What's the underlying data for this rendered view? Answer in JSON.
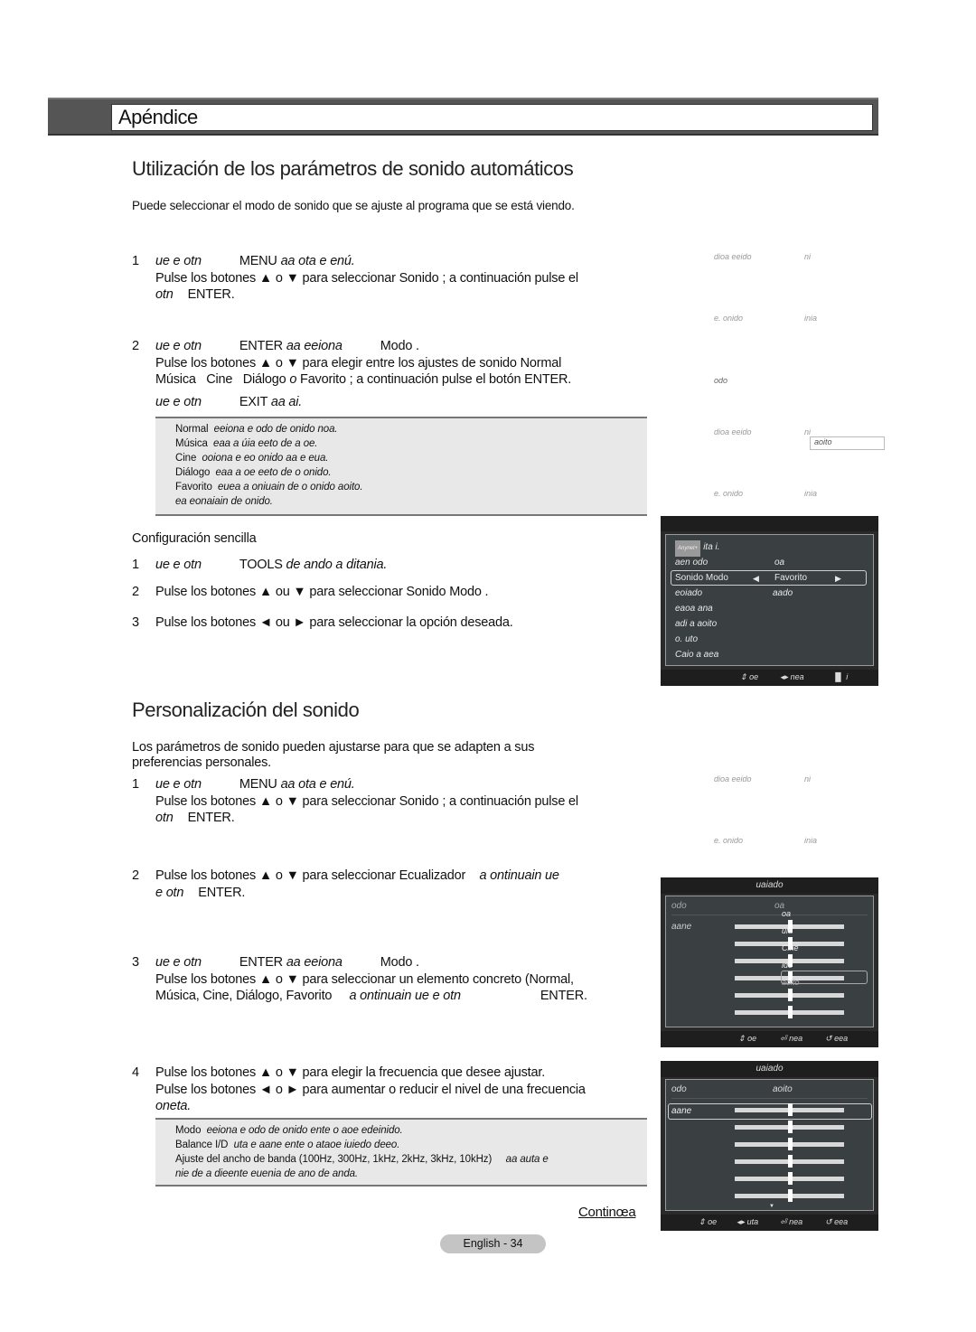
{
  "header": {
    "section_title": "Apéndice"
  },
  "section1": {
    "title": "Utilización de los parámetros de sonido automáticos",
    "intro": "Puede seleccionar el modo de sonido que se ajuste al programa que se está viendo.",
    "steps": [
      {
        "num": "1",
        "line1_a": "ue e otn",
        "line1_b": "MENU",
        "line1_c": "aa ota e enú.",
        "line2": "Pulse los botones ▲ o ▼ para seleccionar Sonido ; a continuación pulse el",
        "line3_a": "otn",
        "line3_b": "ENTER."
      },
      {
        "num": "2",
        "line1_a": "ue e otn",
        "line1_b": "ENTER",
        "line1_c": "aa eeiona",
        "line1_d": "Modo .",
        "line2": "Pulse los botones ▲ o ▼ para elegir entre los ajustes de sonido Normal",
        "line3_a": "Música   Cine   Diálogo ",
        "line3_b": "o",
        "line3_c": " Favorito ; a continuación pulse el botón ENTER.",
        "line4_a": "ue e otn",
        "line4_b": "EXIT",
        "line4_c": "aa ai."
      }
    ],
    "note": [
      {
        "label": "Normal",
        "text": "eeiona e odo de onido noa."
      },
      {
        "label": "Música",
        "text": "eaa a úia eeto de a oe."
      },
      {
        "label": "Cine",
        "text": "ooiona e eo onido aa e eua."
      },
      {
        "label": "Diálogo",
        "text": "eaa a oe eeto de o onido."
      },
      {
        "label": "Favorito",
        "text": "euea a oniuain de o onido aoito."
      },
      {
        "label": "",
        "text": "ea eonaiain de onido."
      }
    ],
    "quick_setup": {
      "title": "Configuración sencilla",
      "steps": [
        {
          "num": "1",
          "a": "ue e otn",
          "b": "TOOLS",
          "c": "de ando a ditania."
        },
        {
          "num": "2",
          "text": "Pulse los botones ▲ ou ▼ para seleccionar Sonido Modo  ."
        },
        {
          "num": "3",
          "text": "Pulse los botones ◄ ou ► para seleccionar la opción deseada."
        }
      ]
    }
  },
  "section2": {
    "title": "Personalización del sonido",
    "intro_line1": "Los parámetros de sonido pueden ajustarse para que se adapten a sus",
    "intro_line2": "preferencias personales.",
    "steps": [
      {
        "num": "1",
        "line1_a": "ue e otn",
        "line1_b": "MENU",
        "line1_c": "aa ota e enú.",
        "line2": "Pulse los botones ▲ o ▼ para seleccionar Sonido ; a continuación pulse el",
        "line3_a": "otn",
        "line3_b": "ENTER."
      },
      {
        "num": "2",
        "line1_a": "Pulse los botones ▲ o ▼ para seleccionar Ecualizador",
        "line1_b": "a ontinuain ue",
        "line2_a": "e otn",
        "line2_b": "ENTER."
      },
      {
        "num": "3",
        "line1_a": "ue e otn",
        "line1_b": "ENTER",
        "line1_c": "aa eeiona",
        "line1_d": "Modo .",
        "line2": "Pulse los botones ▲ o ▼ para seleccionar un elemento concreto (Normal,",
        "line3_a": "Música, Cine, Diálogo, Favorito",
        "line3_b": "a ontinuain ue e otn",
        "line3_c": "ENTER."
      },
      {
        "num": "4",
        "line1": "Pulse los botones ▲ o ▼ para elegir la frecuencia que desee ajustar.",
        "line2": "Pulse los botones ◄ o ► para aumentar o reducir el nivel de una frecuencia",
        "line3": "oneta."
      }
    ],
    "note": [
      {
        "label": "Modo",
        "text": "eeiona e odo de onido ente o aoe edeinido."
      },
      {
        "label": "Balance I/D",
        "text": "uta e aane ente o ataoe iuiedo  deeo."
      },
      {
        "label": "Ajuste del ancho de banda (100Hz, 300Hz, 1kHz, 2kHz, 3kHz, 10kHz)",
        "text": "aa auta e"
      },
      {
        "label": "",
        "text": "nie de a dieente euenia de ano de anda."
      }
    ]
  },
  "ghost_labels": {
    "g1a": "dioa eeido",
    "g1b": "ni",
    "g2a": "e. onido",
    "g2b": "inia",
    "g3a": "odo",
    "g4a": "dioa eeido",
    "g4b": "ni",
    "g4box": "aoito",
    "g5a": "e. onido",
    "g5b": "inia",
    "g6a": "dioa eeido",
    "g6b": "ni",
    "g7a": "e. onido",
    "g7b": "inia"
  },
  "osd_tools": {
    "logo": "Anynet+",
    "items": [
      {
        "label": "ita i.",
        "value": ""
      },
      {
        "label": "aen odo",
        "value": "oa"
      },
      {
        "label": "Sonido Modo",
        "value": "Favorito",
        "selected": true
      },
      {
        "label": "eoiado",
        "value": "aado"
      },
      {
        "label": "eaoa ana",
        "value": ""
      },
      {
        "label": "adi a aoito",
        "value": ""
      },
      {
        "label": "o. uto",
        "value": ""
      },
      {
        "label": "Caio a aea",
        "value": ""
      }
    ],
    "footer": {
      "move": "oe",
      "enter": "nea",
      "exit": "i"
    }
  },
  "osd_eq1": {
    "title": "uaiado",
    "mode_label": "odo",
    "mode_value": "oa",
    "balance_label": "aane",
    "dropdown": [
      "oa",
      "úia",
      "Cine",
      "ido",
      "aoito"
    ],
    "sliders": [
      0.5,
      0.5,
      0.5,
      0.5,
      0.5,
      0.5
    ],
    "footer": {
      "move": "oe",
      "enter": "nea",
      "return": "eea"
    }
  },
  "osd_eq2": {
    "title": "uaiado",
    "mode_label": "odo",
    "mode_value": "aoito",
    "balance_label": "aane",
    "sliders": [
      0.5,
      0.5,
      0.5,
      0.5,
      0.5,
      0.5
    ],
    "footer": {
      "move": "oe",
      "adjust": "uta",
      "enter": "nea",
      "return": "eea"
    }
  },
  "footer": {
    "continue": "Continœa",
    "page": "English - 34"
  }
}
